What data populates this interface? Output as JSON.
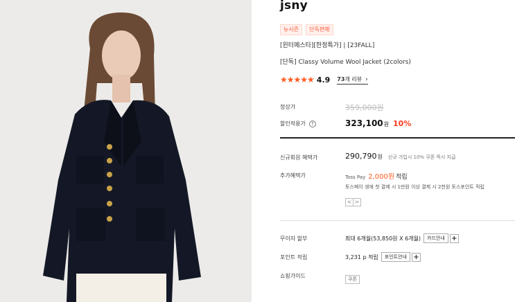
{
  "brand": "jsny",
  "tags": [
    "뉴시즌",
    "단독판매"
  ],
  "subtitle": "[윈터페스타][한정특가] | [23FALL]",
  "product_name": "[단독] Classy Volume Wool Jacket (2colors)",
  "rating": {
    "stars": "★★★★★",
    "score": "4.9",
    "review_count": "73",
    "review_suffix": "개 리뷰",
    "chevron": "›"
  },
  "price": {
    "list_label": "정상가",
    "list_price": "359,000원",
    "sale_label": "할인적용가",
    "help_icon": "?",
    "sale_price": "323,100",
    "won": "원",
    "discount": "10%"
  },
  "benefits": {
    "member_label": "신규회원 혜택가",
    "member_price": "290,790",
    "won": "원",
    "member_note": "신규 가입시 10% 쿠폰 즉시 지급",
    "extra_label": "추가혜택가",
    "toss_prefix": "Toss Pay",
    "toss_points": "2,000원",
    "toss_earn": "적립",
    "toss_desc": "토스페이 생애 첫 결제 시 1만원 이상 결제 시 2천원 토스포인트 적립",
    "prev": "<",
    "next": ">"
  },
  "installment": {
    "label": "무이자 할부",
    "value": "최대 6개월(53,850원 X 6개월)",
    "card_button": "카드안내",
    "plus": "+"
  },
  "points": {
    "label": "포인트 적립",
    "value": "3,231 p 적립",
    "guide_button": "포인트안내",
    "plus": "+"
  },
  "shopping": {
    "label": "쇼핑가이드",
    "coupon": "쿠폰"
  },
  "colors": {
    "accent": "#ff5a1f",
    "discount": "#ff3c1e",
    "jacket": "#141826",
    "button_gold": "#c9a24a"
  }
}
